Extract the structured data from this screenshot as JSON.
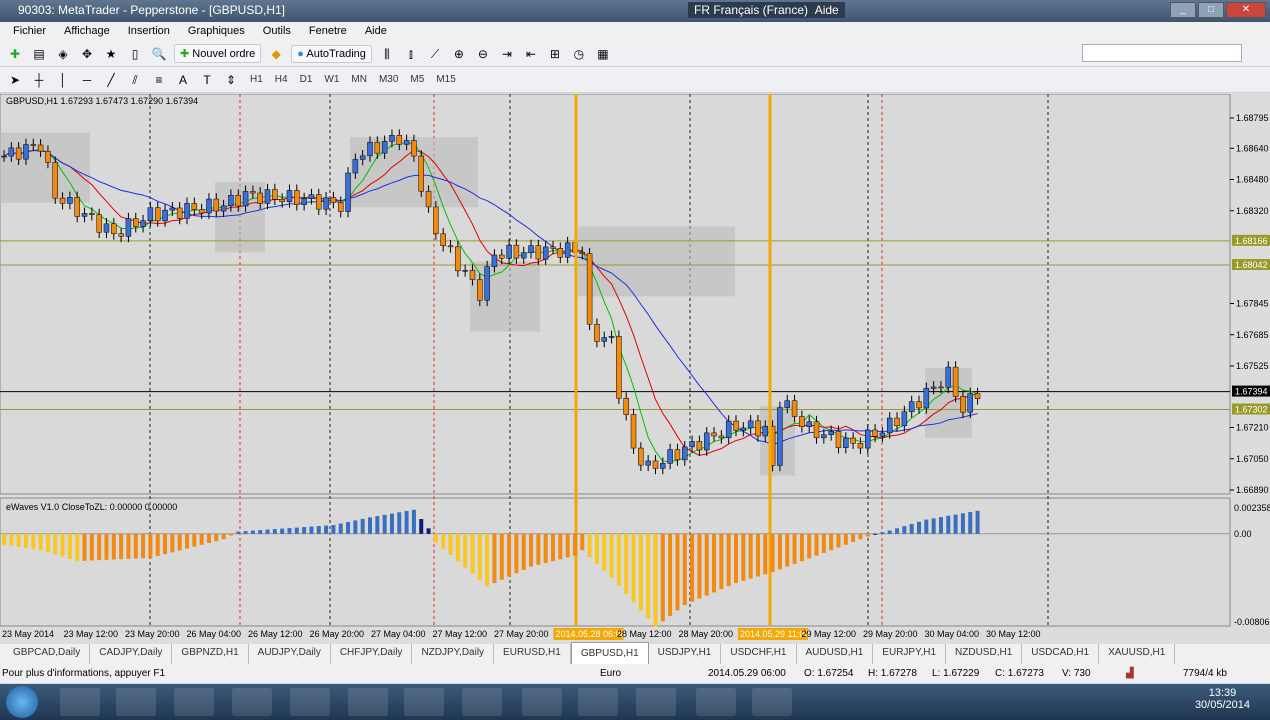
{
  "window": {
    "title": "90303: MetaTrader - Pepperstone - [GBPUSD,H1]",
    "language": "FR Français (France)",
    "help": "Aide"
  },
  "menu": [
    "Fichier",
    "Affichage",
    "Insertion",
    "Graphiques",
    "Outils",
    "Fenetre",
    "Aide"
  ],
  "toolbar": {
    "new_order": "Nouvel ordre",
    "autotrading": "AutoTrading",
    "timeframes": [
      "H1",
      "H4",
      "D1",
      "W1",
      "MN",
      "M30",
      "M5",
      "M15"
    ]
  },
  "chart_data": {
    "type": "candlestick",
    "symbol_label": "GBPUSD,H1  1.67293 1.67473 1.67290 1.67394",
    "price_ticks": [
      "1.68795",
      "1.68640",
      "1.68480",
      "1.68320",
      "1.67845",
      "1.67685",
      "1.67525",
      "1.67210",
      "1.67050",
      "1.66890"
    ],
    "price_range": [
      1.6689,
      1.68795
    ],
    "marked_prices": [
      {
        "label": "1.68166",
        "value": 1.68166,
        "color": "#9a9a2a"
      },
      {
        "label": "1.68042",
        "value": 1.68042,
        "color": "#9a9a2a"
      },
      {
        "label": "1.67302",
        "value": 1.67302,
        "color": "#9a9a2a"
      },
      {
        "label": "1.67394",
        "value": 1.67394,
        "color": "#000000"
      }
    ],
    "price_path": [
      [
        0,
        1.686
      ],
      [
        5,
        1.6866
      ],
      [
        7,
        1.684
      ],
      [
        11,
        1.683
      ],
      [
        15,
        1.682
      ],
      [
        20,
        1.683
      ],
      [
        30,
        1.6835
      ],
      [
        33,
        1.684
      ],
      [
        41,
        1.6838
      ],
      [
        46,
        1.6835
      ],
      [
        48,
        1.686
      ],
      [
        54,
        1.687
      ],
      [
        56,
        1.686
      ],
      [
        58,
        1.683
      ],
      [
        60,
        1.6815
      ],
      [
        65,
        1.679
      ],
      [
        67,
        1.681
      ],
      [
        77,
        1.6812
      ],
      [
        79,
        1.6812
      ],
      [
        80,
        1.677
      ],
      [
        83,
        1.6765
      ],
      [
        84,
        1.674
      ],
      [
        86,
        1.671
      ],
      [
        88,
        1.67
      ],
      [
        93,
        1.671
      ],
      [
        100,
        1.6722
      ],
      [
        104,
        1.672
      ],
      [
        105,
        1.67
      ],
      [
        106,
        1.6735
      ],
      [
        110,
        1.672
      ],
      [
        116,
        1.6712
      ],
      [
        121,
        1.6722
      ],
      [
        125,
        1.6735
      ],
      [
        129,
        1.6748
      ],
      [
        131,
        1.673
      ],
      [
        133,
        1.67394
      ]
    ],
    "ma_colors": {
      "fast": "#00c000",
      "mid": "#e00000",
      "slow": "#2030e0"
    },
    "indicator": {
      "label": "eWaves V1.0 CloseToZL: 0.00000 0.00000",
      "ticks": [
        "0.002358",
        "0.00",
        "-0.00806"
      ],
      "range": [
        -0.00806,
        0.002358
      ],
      "path": [
        [
          0,
          -0.001
        ],
        [
          5,
          -0.0015
        ],
        [
          10,
          -0.0025
        ],
        [
          20,
          -0.0022
        ],
        [
          30,
          -0.0005
        ],
        [
          32,
          0.0002
        ],
        [
          45,
          0.0008
        ],
        [
          50,
          0.0015
        ],
        [
          56,
          0.0022
        ],
        [
          58,
          0.0005
        ],
        [
          59,
          -0.0008
        ],
        [
          66,
          -0.0048
        ],
        [
          72,
          -0.003
        ],
        [
          78,
          -0.002
        ],
        [
          79,
          -0.0015
        ],
        [
          83,
          -0.004
        ],
        [
          89,
          -0.0085
        ],
        [
          93,
          -0.0065
        ],
        [
          100,
          -0.0045
        ],
        [
          105,
          -0.0035
        ],
        [
          115,
          -0.001
        ],
        [
          119,
          0
        ],
        [
          121,
          0.0003
        ],
        [
          126,
          0.0013
        ],
        [
          133,
          0.0021
        ]
      ],
      "colors": {
        "pos_light": "#3a6fc0",
        "pos_dark": "#0a1a80",
        "neg_light": "#f8c820",
        "neg_dark": "#f08a10"
      }
    },
    "time_labels": [
      "23 May 2014",
      "23 May 12:00",
      "23 May 20:00",
      "26 May 04:00",
      "26 May 12:00",
      "26 May 20:00",
      "27 May 04:00",
      "27 May 12:00",
      "27 May 20:00",
      "2014.05.28 06:00",
      "28 May 12:00",
      "28 May 20:00",
      "2014.05.29 11:00",
      "29 May 12:00",
      "29 May 20:00",
      "30 May 04:00",
      "30 May 12:00"
    ],
    "vertical_markers_color": "#f5a800"
  },
  "symbol_tabs": [
    "GBPCAD,Daily",
    "CADJPY,Daily",
    "GBPNZD,H1",
    "AUDJPY,Daily",
    "CHFJPY,Daily",
    "NZDJPY,Daily",
    "EURUSD,H1",
    "GBPUSD,H1",
    "USDJPY,H1",
    "USDCHF,H1",
    "AUDUSD,H1",
    "EURJPY,H1",
    "NZDUSD,H1",
    "USDCAD,H1",
    "XAUUSD,H1"
  ],
  "active_tab": "GBPUSD,H1",
  "status": {
    "help": "Pour plus d'informations, appuyer F1",
    "profile": "Euro",
    "time": "2014.05.29 06:00",
    "open": "O: 1.67254",
    "high": "H: 1.67278",
    "low": "L: 1.67229",
    "close": "C: 1.67273",
    "volume": "V: 730",
    "traffic": "7794/4 kb"
  },
  "taskbar": {
    "time": "13:39",
    "date": "30/05/2014"
  }
}
